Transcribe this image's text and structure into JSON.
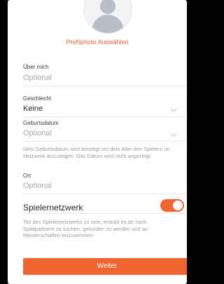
{
  "profile": {
    "choose_photo_label": "Profilphoto Auswählen"
  },
  "form": {
    "about": {
      "label": "Über mich",
      "placeholder": "Optional"
    },
    "gender": {
      "label": "Geschlecht",
      "value": "Keine"
    },
    "birthdate": {
      "label": "Geburtsdatum",
      "value": "Optional",
      "help": "Dein Geburtsdatum wird benötigt um dein Alter den Spielern im Netzwerk anzuzeigen. Das Datum wird nicht angezeigt."
    },
    "location": {
      "label": "Ort",
      "placeholder": "Optional"
    }
  },
  "network": {
    "title": "Spielernetzwerk",
    "enabled": true,
    "help": "Teil des Spielernetzwerks zu sein, erlaubt es dir nach Spielpartnern zu suchen, gefunden zu werden und an Meisterschaften teilzunehmen."
  },
  "actions": {
    "continue_label": "Weiter"
  },
  "colors": {
    "accent": "#f06432",
    "placeholder": "#a8a8a8",
    "text": "#2b2b2b"
  },
  "icons": [
    "avatar-placeholder-icon",
    "chevron-down-icon",
    "toggle-switch"
  ]
}
